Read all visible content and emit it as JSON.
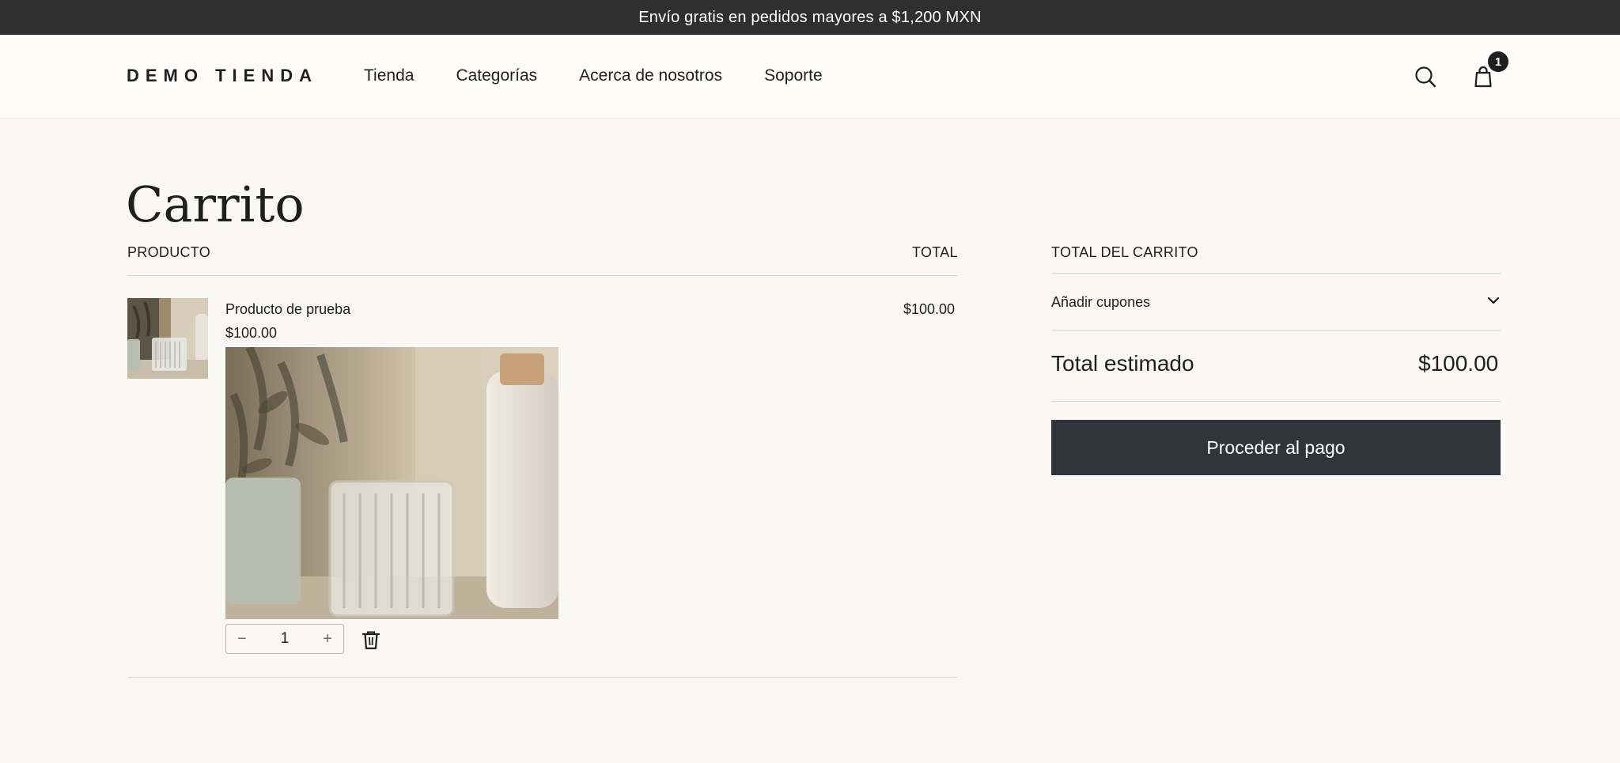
{
  "announcement": {
    "text": "Envío gratis en pedidos mayores a $1,200 MXN"
  },
  "header": {
    "logo": "DEMO TIENDA",
    "nav": [
      "Tienda",
      "Categorías",
      "Acerca de nosotros",
      "Soporte"
    ],
    "cart_count": "1",
    "icons": {
      "search": "search-icon",
      "cart": "shopping-bag-icon"
    }
  },
  "cart": {
    "title": "Carrito",
    "product_header": "PRODUCTO",
    "total_header": "TOTAL",
    "items": [
      {
        "name": "Producto de prueba",
        "price": "$100.00",
        "line_total": "$100.00",
        "quantity": "1",
        "decrement": "−",
        "increment": "+"
      }
    ]
  },
  "summary": {
    "title": "TOTAL DEL CARRITO",
    "coupons_label": "Añadir cupones",
    "estimated_label": "Total estimado",
    "estimated_value": "$100.00",
    "checkout_label": "Proceder al pago"
  },
  "colors": {
    "announcement_bg": "#2f2f2f",
    "page_bg": "#faf8f4",
    "button_bg": "#30353c",
    "text": "#1f1f1f"
  }
}
